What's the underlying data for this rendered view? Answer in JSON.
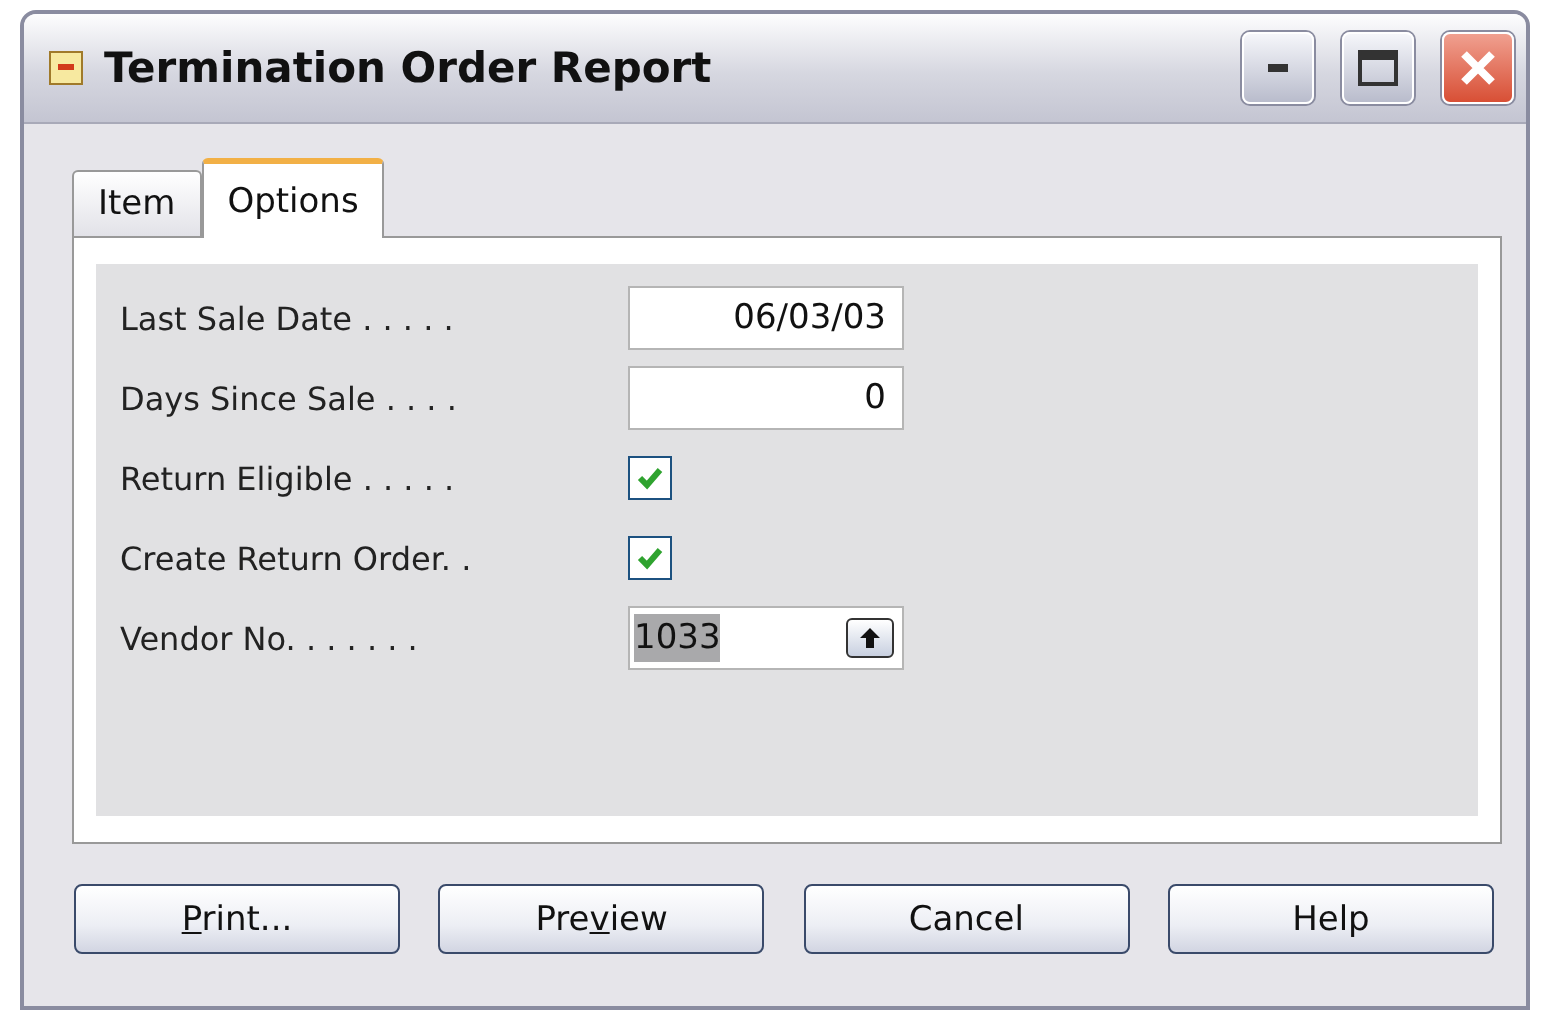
{
  "window": {
    "title": "Termination Order Report"
  },
  "tabs": [
    {
      "label": "Item",
      "selected": false
    },
    {
      "label": "Options",
      "selected": true
    }
  ],
  "fields": [
    {
      "kind": "text",
      "label": "Last Sale Date . . . . .",
      "value": "06/03/03"
    },
    {
      "kind": "text",
      "label": "Days Since Sale . . . .",
      "value": "0"
    },
    {
      "kind": "checkbox",
      "label": "Return Eligible . . . . .",
      "checked": true
    },
    {
      "kind": "checkbox",
      "label": "Create Return Order. .",
      "checked": true
    },
    {
      "kind": "lookup",
      "label": "Vendor No. . . . . . .",
      "value": "1033",
      "highlighted": true
    }
  ],
  "buttons": [
    {
      "key": "P",
      "after": "rint..."
    },
    {
      "before": "Pre",
      "key": "v",
      "after": "iew"
    },
    {
      "before": "Cancel"
    },
    {
      "before": "Help"
    }
  ]
}
